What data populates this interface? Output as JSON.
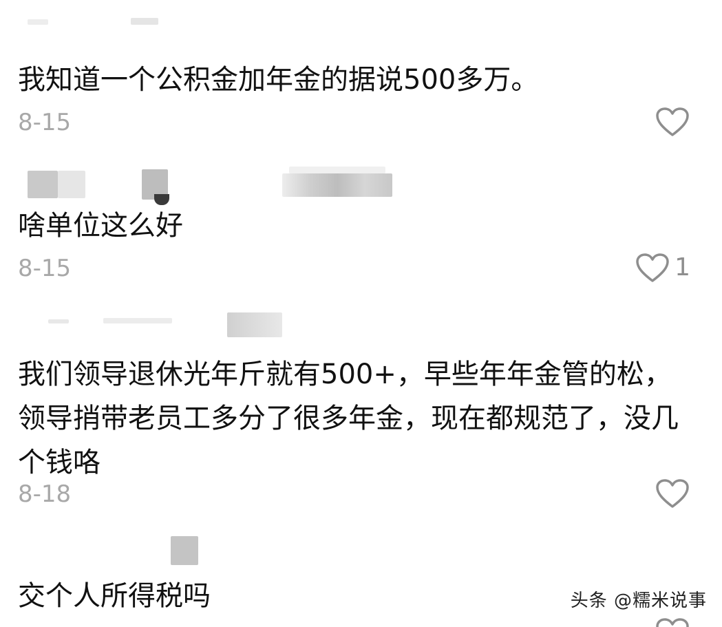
{
  "comments": [
    {
      "text": "我知道一个公积金加年金的据说500多万。",
      "date": "8-15",
      "likes": ""
    },
    {
      "text": "啥单位这么好",
      "date": "8-15",
      "likes": "1"
    },
    {
      "text": "我们领导退休光年斤就有500+，早些年年金管的松，领导捎带老员工多分了很多年金，现在都规范了，没几个钱咯",
      "date": "8-18",
      "likes": ""
    },
    {
      "text": "交个人所得税吗",
      "date": "",
      "likes": ""
    }
  ],
  "watermark": "头条 @糯米说事",
  "colors": {
    "text": "#111111",
    "meta": "#a8a8a8",
    "icon_stroke": "#8e8e8e",
    "blur_gray": "#b4b4b4"
  },
  "icons": {
    "like": "heart-outline-icon"
  }
}
